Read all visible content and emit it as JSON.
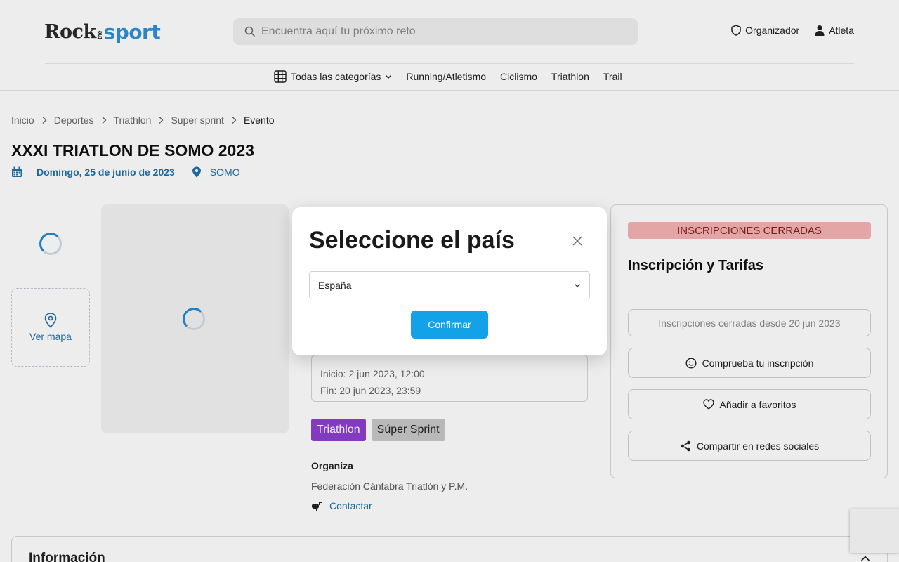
{
  "header": {
    "logo": {
      "rock": "Rock",
      "the": "the",
      "sport": "sport"
    },
    "search": {
      "placeholder": "Encuentra aquí tu próximo reto",
      "icon": "search-icon"
    },
    "links": {
      "organizer": "Organizador",
      "athlete": "Atleta"
    },
    "categories": {
      "all": "Todas las categorías",
      "items": [
        "Running/Atletismo",
        "Ciclismo",
        "Triathlon",
        "Trail"
      ]
    }
  },
  "breadcrumb": [
    "Inicio",
    "Deportes",
    "Triathlon",
    "Super sprint",
    "Evento"
  ],
  "event": {
    "title": "XXXI TRIATLON DE SOMO 2023",
    "date": "Domingo, 25 de junio de 2023",
    "location": "SOMO",
    "map_label": "Ver mapa",
    "registration_start": "Inicio: 2 jun 2023, 12:00",
    "registration_end": "Fin: 20 jun 2023, 23:59",
    "tags": [
      "Triathlon",
      "Súper Sprint"
    ],
    "organizer_heading": "Organiza",
    "organizer_name": "Federación Cántabra Triatlón y P.M.",
    "contact_label": "Contactar"
  },
  "panel": {
    "status_badge": "INSCRIPCIONES CERRADAS",
    "title": "Inscripción y Tarifas",
    "closed_since": "Inscripciones cerradas desde 20 jun 2023",
    "check_registration": "Comprueba tu inscripción",
    "add_favorites": "Añadir a favoritos",
    "share": "Compartir en redes sociales"
  },
  "info": {
    "title": "Información"
  },
  "modal": {
    "title": "Seleccione el país",
    "selected_country": "España",
    "confirm_label": "Confirmar"
  },
  "colors": {
    "accent": "#13a1e8",
    "link": "#1f6fa8",
    "tag_triathlon": "#8b3fcf",
    "closed_badge": "#f5b3b3"
  }
}
